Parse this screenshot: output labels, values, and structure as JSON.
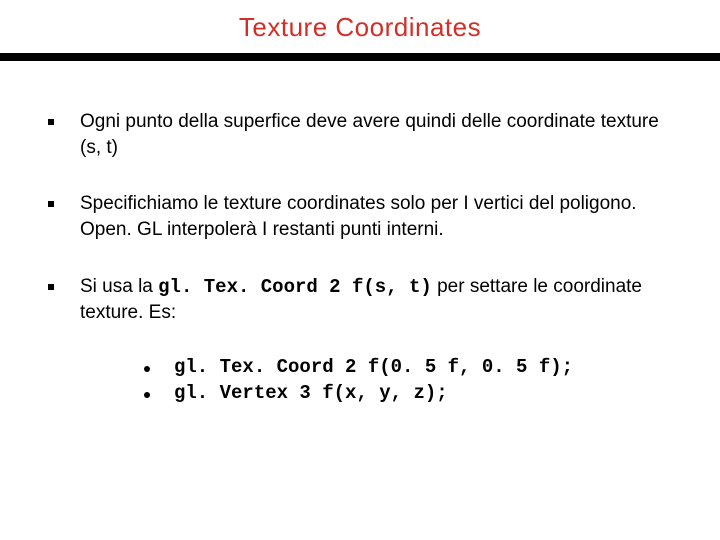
{
  "title": "Texture Coordinates",
  "bullets": [
    {
      "pre": "Ogni punto della superfice deve avere quindi delle coordinate texture (s, t)",
      "code": "",
      "post": ""
    },
    {
      "pre": "Specifichiamo le texture coordinates solo per I vertici del poligono. Open. GL interpolerà I restanti punti interni.",
      "code": "",
      "post": ""
    },
    {
      "pre": "Si usa la ",
      "code": "gl. Tex. Coord 2 f(s, t)",
      "post": " per settare le coordinate texture. Es:"
    }
  ],
  "sub_bullets": [
    "gl. Tex. Coord 2 f(0. 5 f, 0. 5 f);",
    "gl. Vertex 3 f(x, y, z);"
  ]
}
